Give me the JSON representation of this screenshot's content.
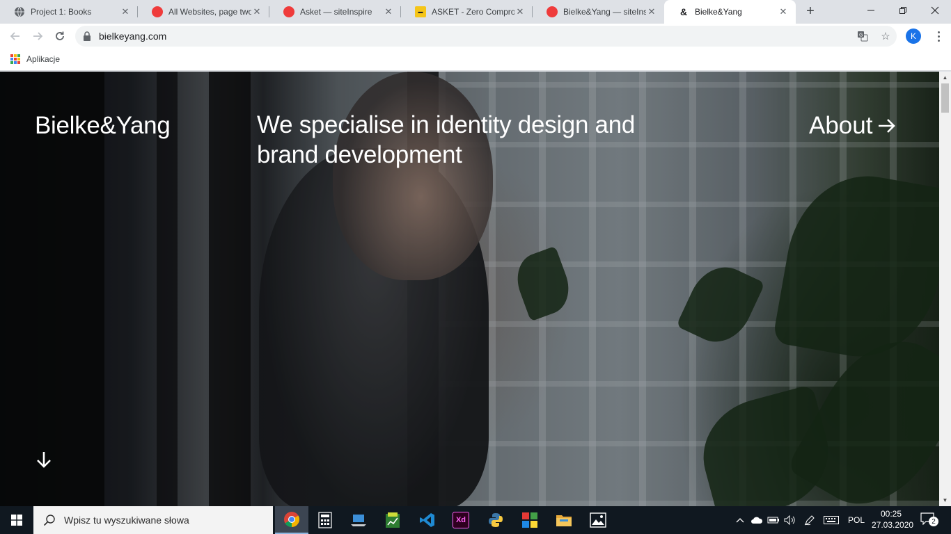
{
  "browser": {
    "tabs": [
      {
        "title": "Project 1: Books",
        "favicon": "globe-icon",
        "color": "#5f6368"
      },
      {
        "title": "All Websites, page two",
        "favicon": "siteinspire-icon",
        "color": "#ef3b3b"
      },
      {
        "title": "Asket — siteInspire",
        "favicon": "siteinspire-icon",
        "color": "#ef3b3b"
      },
      {
        "title": "ASKET - Zero Compromise",
        "favicon": "asket-icon",
        "color": "#f5c518"
      },
      {
        "title": "Bielke&Yang — siteInspire",
        "favicon": "siteinspire-icon",
        "color": "#ef3b3b"
      },
      {
        "title": "Bielke&Yang",
        "favicon": "ampersand-icon",
        "color": "#202124",
        "glyph": "&"
      }
    ],
    "url": "bielkeyang.com",
    "profile_initial": "K",
    "bookmarks": [
      {
        "label": "Aplikacje"
      }
    ]
  },
  "page": {
    "brand": "Bielke&Yang",
    "tagline": "We specialise in identity design and brand development",
    "nav_about": "About"
  },
  "taskbar": {
    "search_placeholder": "Wpisz tu wyszukiwane słowa",
    "language": "POL",
    "time": "00:25",
    "date": "27.03.2020",
    "notification_count": "2"
  },
  "colors": {
    "accent_blue": "#1a73e8",
    "siteinspire_red": "#ef3b3b",
    "taskbar_bg": "#101820"
  }
}
